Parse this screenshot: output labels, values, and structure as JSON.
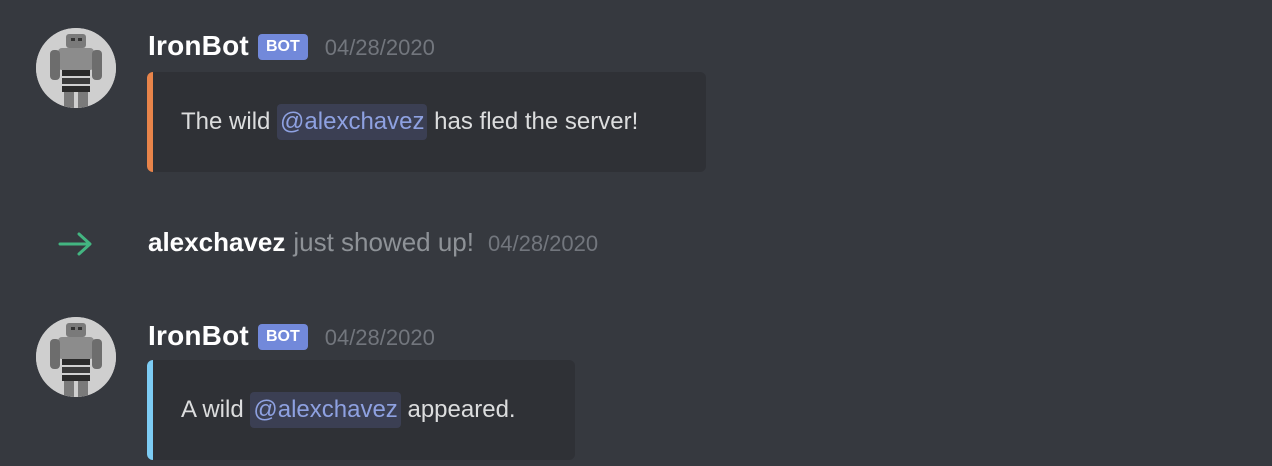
{
  "messages": [
    {
      "username": "IronBot",
      "tag": "BOT",
      "timestamp": "04/28/2020",
      "embed": {
        "prefix": "The wild",
        "mention": "@alexchavez",
        "suffix": "has fled the server!",
        "accent_color": "#e8844a"
      }
    },
    {
      "username": "IronBot",
      "tag": "BOT",
      "timestamp": "04/28/2020",
      "embed": {
        "prefix": "A wild",
        "mention": "@alexchavez",
        "suffix": "appeared.",
        "accent_color": "#7dccf4"
      }
    }
  ],
  "join_event": {
    "icon": "join-arrow-icon",
    "username": "alexchavez",
    "text": "just showed up!",
    "timestamp": "04/28/2020",
    "icon_color": "#43b581"
  },
  "colors": {
    "background": "#36393f",
    "embed_background": "#2f3136",
    "bot_tag": "#7289da",
    "mention_text": "#8ea1e1"
  }
}
